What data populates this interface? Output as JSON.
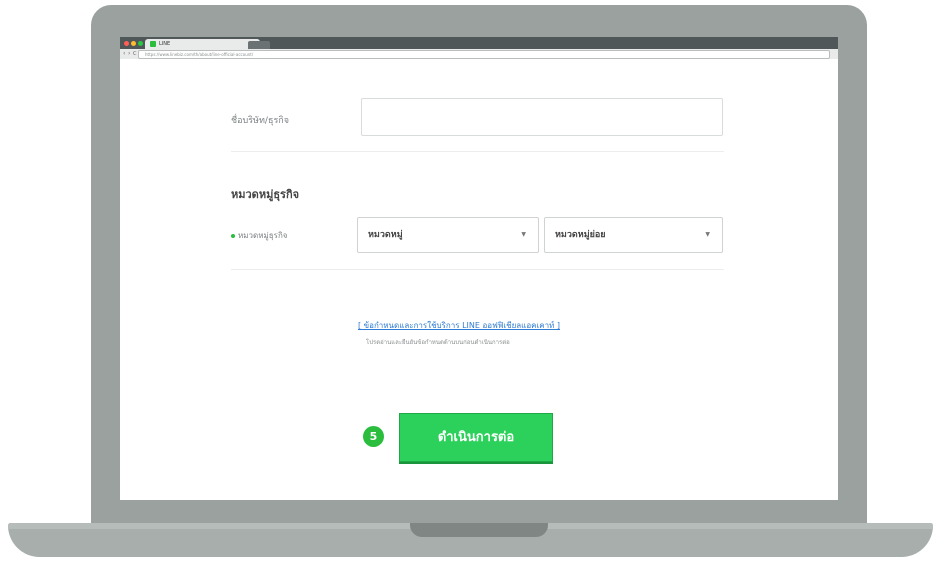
{
  "browser": {
    "tab_title": "LINE",
    "nav_back": "‹",
    "nav_forward": "›",
    "nav_reload": "C",
    "url": "https://www.linebiz.com/th/about/line-official-account/",
    "controls_colors": [
      "#ff5f57",
      "#febc2e",
      "#28c840"
    ]
  },
  "form": {
    "row1": {
      "label": "ชื่อบริษัท/ธุรกิจ",
      "value": ""
    },
    "section": {
      "title": "หมวดหมู่ธุรกิจ",
      "required_label": "หมวดหมู่ธุรกิจ",
      "select1_value": "หมวดหมู่",
      "select2_value": "หมวดหมู่ย่อย",
      "arrow": "▼"
    },
    "terms_link": "[ ข้อกำหนดและการใช้บริการ LINE ออฟฟิเชียลแอคเคาท์ ]",
    "terms_note": "โปรดอ่านและยืนยันข้อกำหนดด้านบนก่อนดำเนินการต่อ"
  },
  "step": {
    "number": "5",
    "button_label": "ดำเนินการต่อ"
  },
  "colors": {
    "accent": "#2bd15a",
    "laptop": "#9aa19f"
  }
}
